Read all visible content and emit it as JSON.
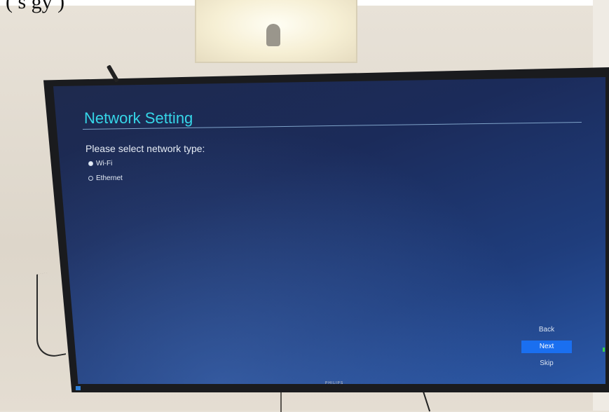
{
  "photo": {
    "top_text": "(       s          gy               )"
  },
  "screen": {
    "title": "Network Setting",
    "prompt": "Please select network type:",
    "options": [
      {
        "label": "Wi-Fi",
        "selected": true
      },
      {
        "label": "Ethernet",
        "selected": false
      }
    ],
    "buttons": {
      "back": "Back",
      "next": "Next",
      "skip": "Skip"
    },
    "brand": "PHILIPS"
  },
  "colors": {
    "title": "#36d6e8",
    "focus_button": "#1a6ff0",
    "screen_top": "#1e2a4d",
    "screen_bottom": "#2a58a8"
  }
}
